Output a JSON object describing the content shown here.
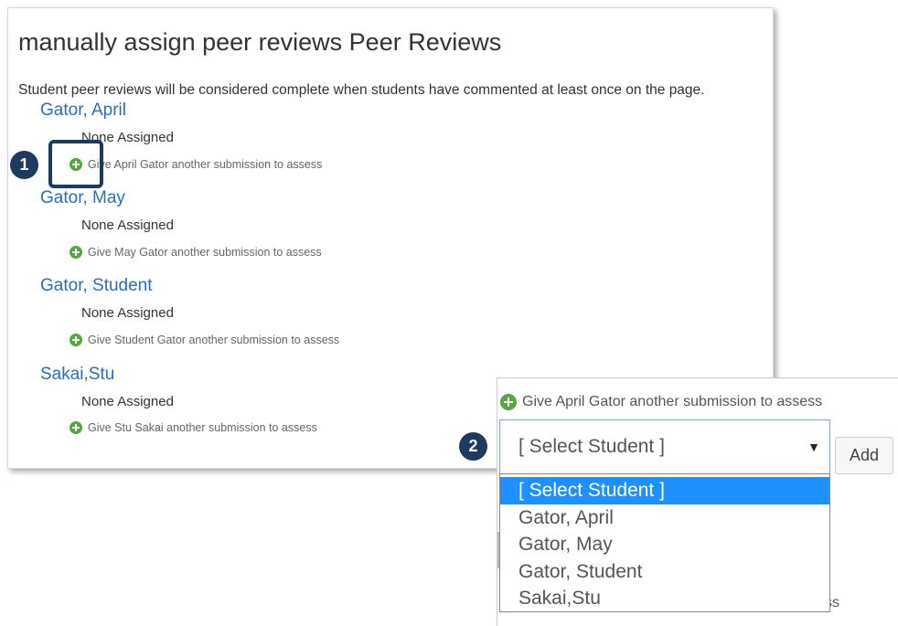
{
  "page": {
    "title": "manually assign peer reviews Peer Reviews",
    "intro": "Student peer reviews will be considered complete when students have commented at least once on the page."
  },
  "students": [
    {
      "name": "Gator, April",
      "assigned": "None Assigned",
      "give_link": "Give April Gator another submission to assess"
    },
    {
      "name": "Gator, May",
      "assigned": "None Assigned",
      "give_link": "Give May Gator another submission to assess"
    },
    {
      "name": "Gator, Student",
      "assigned": "None Assigned",
      "give_link": "Give Student Gator another submission to assess"
    },
    {
      "name": "Sakai,Stu",
      "assigned": "None Assigned",
      "give_link": "Give Stu Sakai another submission to assess"
    }
  ],
  "callouts": {
    "first": "1",
    "second": "2"
  },
  "zoom": {
    "give_link": "Give April Gator another submission to assess",
    "select_value": "[ Select Student ]",
    "add_label": "Add",
    "options": [
      "[ Select Student ]",
      "Gator, April",
      "Gator, May",
      "Gator, Student",
      "Sakai,Stu"
    ],
    "behind_fragment": "ss"
  },
  "icons": {
    "add": "plus-circle-icon",
    "dropdown": "caret-down-icon"
  },
  "colors": {
    "link": "#2a6fb9",
    "plus_icon": "#57a641",
    "callout": "#1f3a5f",
    "selected_option": "#1e90ff"
  }
}
